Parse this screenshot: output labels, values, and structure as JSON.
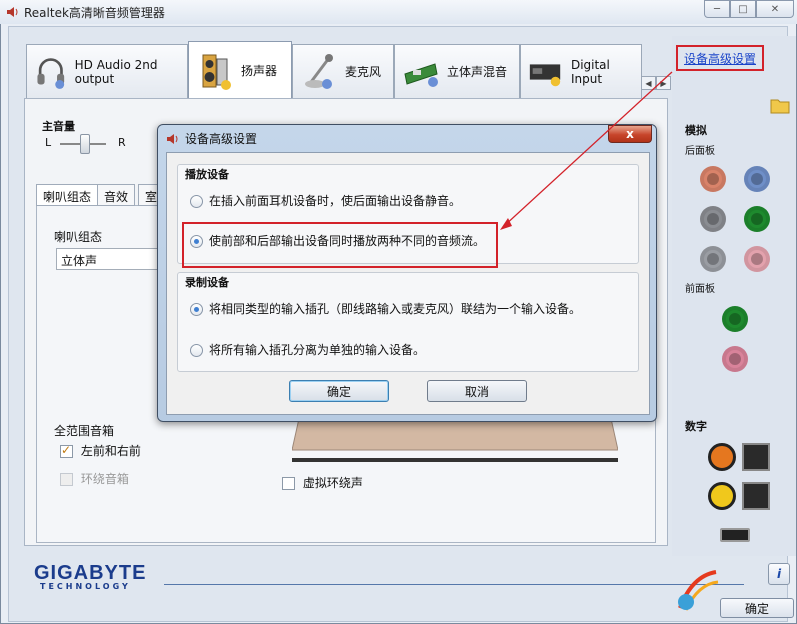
{
  "window": {
    "title": "Realtek高清晰音频管理器"
  },
  "tabs": [
    {
      "label": "HD Audio 2nd output",
      "icon": "headphones-icon"
    },
    {
      "label": "扬声器",
      "icon": "speaker-icon"
    },
    {
      "label": "麦克风",
      "icon": "microphone-icon"
    },
    {
      "label": "立体声混音",
      "icon": "sound-card-icon"
    },
    {
      "label": "Digital Input",
      "icon": "digital-input-icon"
    }
  ],
  "advanced_link": "设备高级设置",
  "main": {
    "volume_label": "主音量",
    "left": "L",
    "right": "R",
    "subtabs": [
      "喇叭组态",
      "音效",
      "室"
    ],
    "speaker_config_label": "喇叭组态",
    "speaker_config_value": "立体声",
    "full_range_label": "全范围音箱",
    "front_lr": "左前和右前",
    "surround": "环绕音箱",
    "virtual_surround": "虚拟环绕声"
  },
  "right_panel": {
    "analog": "模拟",
    "rear_panel": "后面板",
    "front_panel": "前面板",
    "digital": "数字",
    "rear_jacks": [
      "#d9836a",
      "#6f8fc8",
      "#8a8d92",
      "#1e8a2e",
      "#9a9da3",
      "#e3a2ad"
    ],
    "front_jacks": [
      "#1e8a2e",
      "#d9839a"
    ]
  },
  "dialog": {
    "title": "设备高级设置",
    "close": "x",
    "playback_group": "播放设备",
    "playback_opt1": "在插入前面耳机设备时，使后面输出设备静音。",
    "playback_opt2": "使前部和后部输出设备同时播放两种不同的音频流。",
    "record_group": "录制设备",
    "record_opt1": "将相同类型的输入插孔（即线路输入或麦克风）联结为一个输入设备。",
    "record_opt2": "将所有输入插孔分离为单独的输入设备。",
    "ok": "确定",
    "cancel": "取消"
  },
  "footer": {
    "brand": "GIGABYTE",
    "brand_sub": "TECHNOLOGY",
    "ok": "确定",
    "info": "i"
  },
  "colors": {
    "highlight_red": "#d3222a",
    "link_blue": "#1a44c9"
  }
}
